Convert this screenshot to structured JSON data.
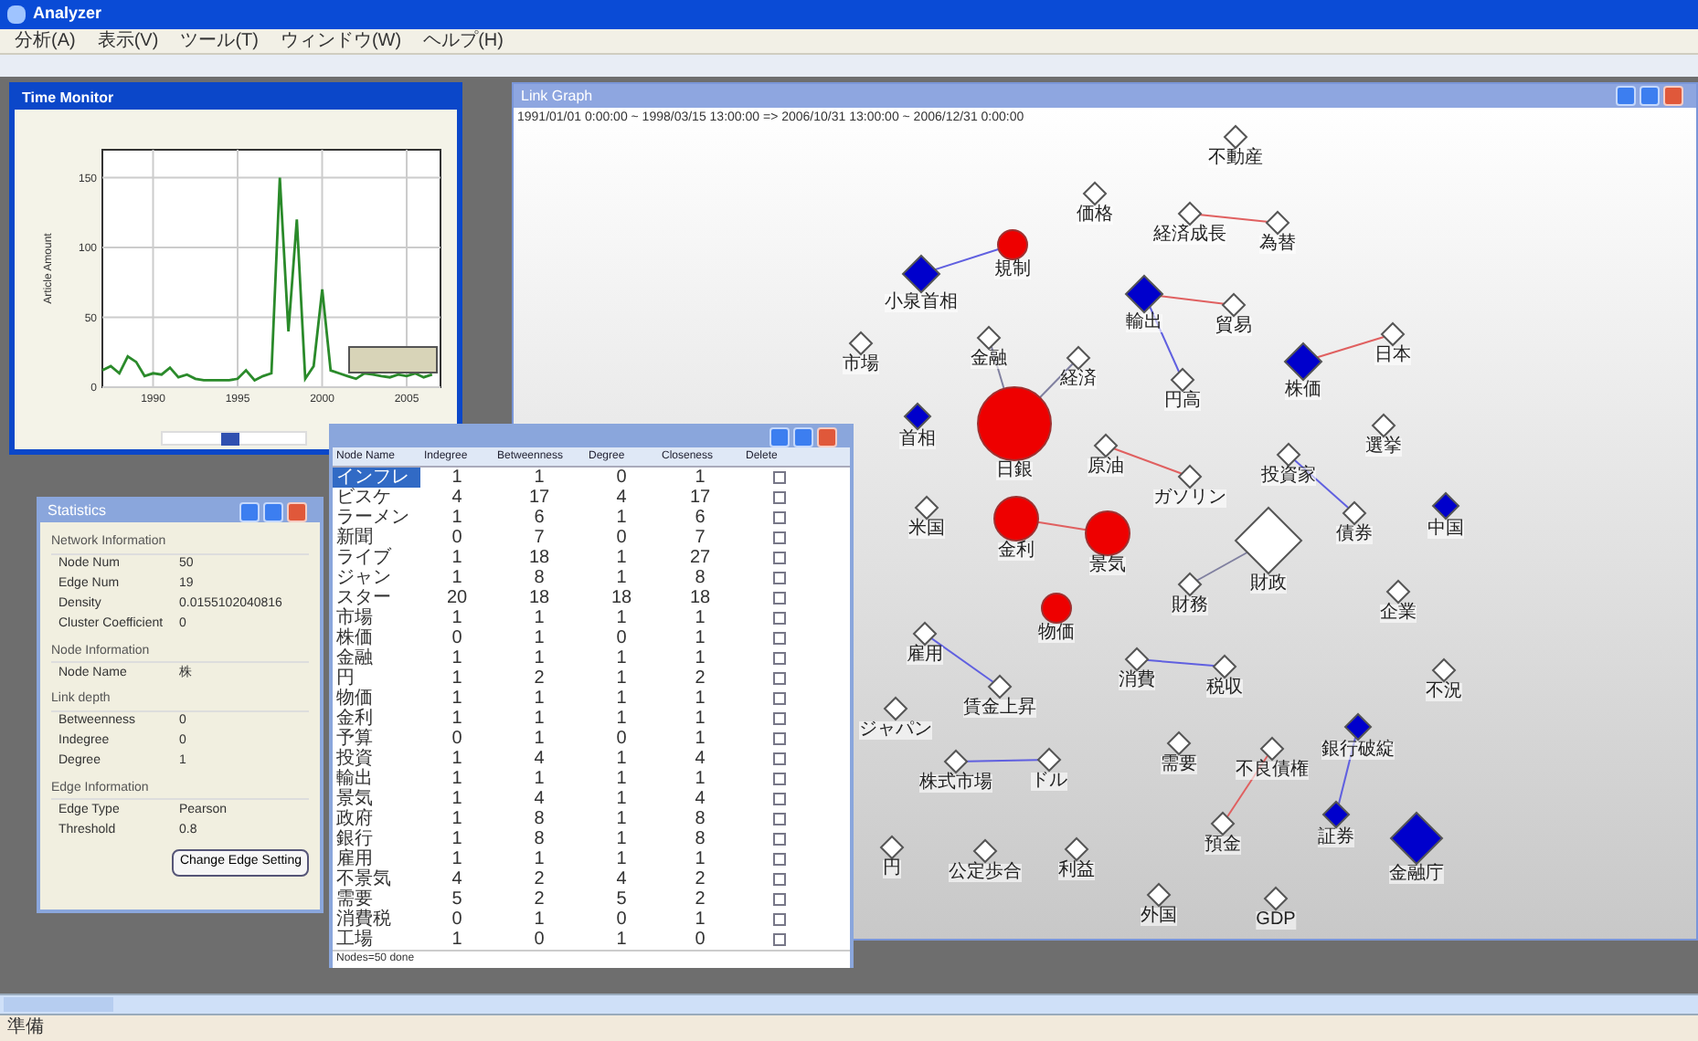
{
  "window": {
    "title": "Analyzer"
  },
  "menu": [
    "分析(A)",
    "表示(V)",
    "ツール(T)",
    "ウィンドウ(W)",
    "ヘルプ(H)"
  ],
  "time_monitor": {
    "title": "Time Monitor",
    "chart_data": {
      "type": "line",
      "ylabel": "Article Amount",
      "x": [
        1987,
        1987.5,
        1988,
        1988.5,
        1989,
        1989.5,
        1990,
        1990.5,
        1991,
        1991.5,
        1992,
        1992.5,
        1993,
        1993.5,
        1994,
        1994.5,
        1995,
        1995.5,
        1996,
        1996.5,
        1997,
        1997.5,
        1998,
        1998.5,
        1999,
        1999.5,
        2000,
        2000.5,
        2001,
        2001.5,
        2002,
        2002.5,
        2003,
        2003.5,
        2004,
        2004.5,
        2005,
        2005.5,
        2006,
        2006.5
      ],
      "series": [
        {
          "color": "#2a8a2a",
          "values": [
            12,
            15,
            10,
            22,
            18,
            8,
            10,
            9,
            14,
            7,
            9,
            6,
            5,
            5,
            5,
            5,
            6,
            12,
            5,
            8,
            10,
            150,
            40,
            120,
            6,
            15,
            70,
            12,
            10,
            8,
            6,
            10,
            9,
            8,
            7,
            9,
            8,
            10,
            7,
            9
          ]
        }
      ],
      "grid": true,
      "xlim": [
        1987,
        2007
      ],
      "ylim": [
        0,
        170
      ],
      "xticks": [
        1990,
        1995,
        2000,
        2005
      ],
      "yticks": [
        0,
        50,
        100,
        150
      ]
    },
    "slider": {
      "level": 0.45
    }
  },
  "statistics": {
    "title": "Statistics",
    "sections": [
      {
        "heading": "Network Information",
        "rows": [
          {
            "label": "Node Num",
            "value": "50"
          },
          {
            "label": "Edge Num",
            "value": "19"
          },
          {
            "label": "Density",
            "value": "0.0155102040816"
          },
          {
            "label": "Cluster Coefficient",
            "value": "0"
          }
        ]
      },
      {
        "heading": "Node Information",
        "rows": [
          {
            "label": "Node Name",
            "value": "株"
          }
        ]
      },
      {
        "heading": "Link depth",
        "rows": [
          {
            "label": "Betweenness",
            "value": "0"
          },
          {
            "label": "Indegree",
            "value": "0"
          },
          {
            "label": "Degree",
            "value": "1"
          }
        ]
      },
      {
        "heading": "Edge Information",
        "rows": [
          {
            "label": "Edge Type",
            "value": "Pearson"
          },
          {
            "label": "Threshold",
            "value": "0.8"
          }
        ]
      }
    ],
    "button": "Change Edge Setting"
  },
  "table": {
    "columns": [
      "Node Name",
      "Indegree",
      "Betweenness",
      "Degree",
      "Closeness",
      "Delete"
    ],
    "rows": [
      {
        "cells": [
          "インフレ",
          "1",
          "1",
          "0",
          "1"
        ],
        "selected": true,
        "checked": false
      },
      {
        "cells": [
          "ビスケ",
          "4",
          "17",
          "4",
          "17"
        ],
        "selected": false,
        "checked": false
      },
      {
        "cells": [
          "ラーメン",
          "1",
          "6",
          "1",
          "6"
        ],
        "selected": false,
        "checked": false
      },
      {
        "cells": [
          "新聞",
          "0",
          "7",
          "0",
          "7"
        ],
        "selected": false,
        "checked": false
      },
      {
        "cells": [
          "ライブ",
          "1",
          "18",
          "1",
          "27"
        ],
        "selected": false,
        "checked": false
      },
      {
        "cells": [
          "ジャン",
          "1",
          "8",
          "1",
          "8"
        ],
        "selected": false,
        "checked": false
      },
      {
        "cells": [
          "スター",
          "20",
          "18",
          "18",
          "18"
        ],
        "selected": false,
        "checked": false
      },
      {
        "cells": [
          "市場",
          "1",
          "1",
          "1",
          "1"
        ],
        "selected": false,
        "checked": false
      },
      {
        "cells": [
          "株価",
          "0",
          "1",
          "0",
          "1"
        ],
        "selected": false,
        "checked": false
      },
      {
        "cells": [
          "金融",
          "1",
          "1",
          "1",
          "1"
        ],
        "selected": false,
        "checked": false
      },
      {
        "cells": [
          "円",
          "1",
          "2",
          "1",
          "2"
        ],
        "selected": false,
        "checked": false
      },
      {
        "cells": [
          "物価",
          "1",
          "1",
          "1",
          "1"
        ],
        "selected": false,
        "checked": false
      },
      {
        "cells": [
          "金利",
          "1",
          "1",
          "1",
          "1"
        ],
        "selected": false,
        "checked": false
      },
      {
        "cells": [
          "予算",
          "0",
          "1",
          "0",
          "1"
        ],
        "selected": false,
        "checked": false
      },
      {
        "cells": [
          "投資",
          "1",
          "4",
          "1",
          "4"
        ],
        "selected": false,
        "checked": false
      },
      {
        "cells": [
          "輸出",
          "1",
          "1",
          "1",
          "1"
        ],
        "selected": false,
        "checked": false
      },
      {
        "cells": [
          "景気",
          "1",
          "4",
          "1",
          "4"
        ],
        "selected": false,
        "checked": false
      },
      {
        "cells": [
          "政府",
          "1",
          "8",
          "1",
          "8"
        ],
        "selected": false,
        "checked": false
      },
      {
        "cells": [
          "銀行",
          "1",
          "8",
          "1",
          "8"
        ],
        "selected": false,
        "checked": false
      },
      {
        "cells": [
          "雇用",
          "1",
          "1",
          "1",
          "1"
        ],
        "selected": false,
        "checked": false
      },
      {
        "cells": [
          "不景気",
          "4",
          "2",
          "4",
          "2"
        ],
        "selected": false,
        "checked": false
      },
      {
        "cells": [
          "需要",
          "5",
          "2",
          "5",
          "2"
        ],
        "selected": false,
        "checked": false
      },
      {
        "cells": [
          "消費税",
          "0",
          "1",
          "0",
          "1"
        ],
        "selected": false,
        "checked": false
      },
      {
        "cells": [
          "工場",
          "1",
          "0",
          "1",
          "0"
        ],
        "selected": false,
        "checked": false
      }
    ],
    "footer": "Nodes=50 done"
  },
  "graph": {
    "title": "Link Graph",
    "period": "1991/01/01 0:00:00 ~ 1998/03/15 13:00:00 => 2006/10/31 13:00:00 ~ 2006/12/31 0:00:00",
    "nodes": [
      {
        "label": "不動産",
        "kind": "diamond",
        "color": "#ffffff"
      },
      {
        "label": "価格",
        "kind": "diamond",
        "color": "#ffffff"
      },
      {
        "label": "経済成長",
        "kind": "diamond",
        "color": "#ffffff"
      },
      {
        "label": "為替",
        "kind": "diamond",
        "color": "#ffffff"
      },
      {
        "label": "規制",
        "kind": "circle",
        "color": "#ee0000"
      },
      {
        "label": "小泉首相",
        "kind": "diamond",
        "color": "#0000cc"
      },
      {
        "label": "輸出",
        "kind": "diamond",
        "color": "#0000cc"
      },
      {
        "label": "貿易",
        "kind": "diamond",
        "color": "#ffffff"
      },
      {
        "label": "市場",
        "kind": "diamond",
        "color": "#ffffff"
      },
      {
        "label": "金融",
        "kind": "diamond",
        "color": "#ffffff"
      },
      {
        "label": "日本",
        "kind": "diamond",
        "color": "#ffffff"
      },
      {
        "label": "経済",
        "kind": "diamond",
        "color": "#ffffff"
      },
      {
        "label": "株価",
        "kind": "diamond",
        "color": "#0000cc"
      },
      {
        "label": "円高",
        "kind": "diamond",
        "color": "#ffffff"
      },
      {
        "label": "首相",
        "kind": "diamond",
        "color": "#0000cc"
      },
      {
        "label": "日銀",
        "kind": "circle",
        "color": "#ee0000"
      },
      {
        "label": "選挙",
        "kind": "diamond",
        "color": "#ffffff"
      },
      {
        "label": "原油",
        "kind": "diamond",
        "color": "#ffffff"
      },
      {
        "label": "投資家",
        "kind": "diamond",
        "color": "#ffffff"
      },
      {
        "label": "ガソリン",
        "kind": "diamond",
        "color": "#ffffff"
      },
      {
        "label": "米国",
        "kind": "diamond",
        "color": "#ffffff"
      },
      {
        "label": "金利",
        "kind": "circle",
        "color": "#ee0000"
      },
      {
        "label": "債券",
        "kind": "diamond",
        "color": "#ffffff"
      },
      {
        "label": "中国",
        "kind": "diamond",
        "color": "#0000cc"
      },
      {
        "label": "景気",
        "kind": "circle",
        "color": "#ee0000"
      },
      {
        "label": "財政",
        "kind": "diamond",
        "color": "#ffffff"
      },
      {
        "label": "財務",
        "kind": "diamond",
        "color": "#ffffff"
      },
      {
        "label": "企業",
        "kind": "diamond",
        "color": "#ffffff"
      },
      {
        "label": "物価",
        "kind": "circle",
        "color": "#ee0000"
      },
      {
        "label": "雇用",
        "kind": "diamond",
        "color": "#ffffff"
      },
      {
        "label": "消費",
        "kind": "diamond",
        "color": "#ffffff"
      },
      {
        "label": "税収",
        "kind": "diamond",
        "color": "#ffffff"
      },
      {
        "label": "不況",
        "kind": "diamond",
        "color": "#ffffff"
      },
      {
        "label": "賃金上昇",
        "kind": "diamond",
        "color": "#ffffff"
      },
      {
        "label": "ジャパン",
        "kind": "diamond",
        "color": "#ffffff"
      },
      {
        "label": "銀行破綻",
        "kind": "diamond",
        "color": "#0000cc"
      },
      {
        "label": "需要",
        "kind": "diamond",
        "color": "#ffffff"
      },
      {
        "label": "不良債権",
        "kind": "diamond",
        "color": "#ffffff"
      },
      {
        "label": "株式市場",
        "kind": "diamond",
        "color": "#ffffff"
      },
      {
        "label": "ドル",
        "kind": "diamond",
        "color": "#ffffff"
      },
      {
        "label": "預金",
        "kind": "diamond",
        "color": "#ffffff"
      },
      {
        "label": "証券",
        "kind": "diamond",
        "color": "#0000cc"
      },
      {
        "label": "円",
        "kind": "diamond",
        "color": "#ffffff"
      },
      {
        "label": "公定歩合",
        "kind": "diamond",
        "color": "#ffffff"
      },
      {
        "label": "利益",
        "kind": "diamond",
        "color": "#ffffff"
      },
      {
        "label": "金融庁",
        "kind": "diamond",
        "color": "#0000cc"
      },
      {
        "label": "外国",
        "kind": "diamond",
        "color": "#ffffff"
      },
      {
        "label": "GDP",
        "kind": "diamond",
        "color": "#ffffff"
      }
    ],
    "edges": [
      {
        "color": "#e06060"
      },
      {
        "color": "#6060e0"
      },
      {
        "color": "#e06060"
      },
      {
        "color": "#6060e0"
      },
      {
        "color": "#e06060"
      },
      {
        "color": "#8080a0"
      },
      {
        "color": "#8080a0"
      },
      {
        "color": "#e06060"
      },
      {
        "color": "#6060e0"
      },
      {
        "color": "#e06060"
      },
      {
        "color": "#8080a0"
      },
      {
        "color": "#6060e0"
      },
      {
        "color": "#6060e0"
      },
      {
        "color": "#6060e0"
      },
      {
        "color": "#e06060"
      },
      {
        "color": "#6060e0"
      }
    ]
  },
  "status_bar": "準備"
}
